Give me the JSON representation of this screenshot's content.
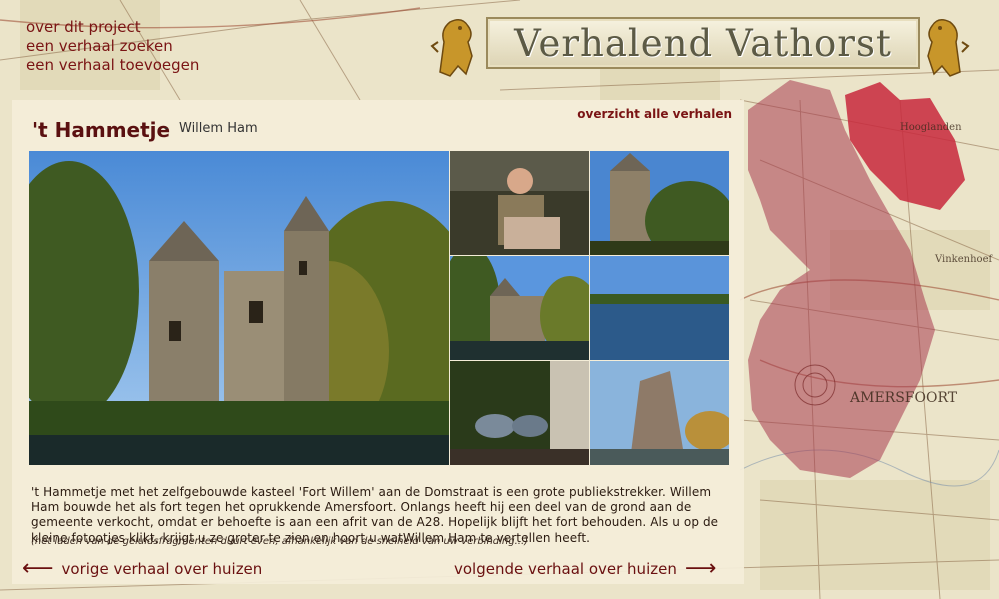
{
  "nav": {
    "items": [
      "over dit project",
      "een verhaal zoeken",
      "een verhaal toevoegen"
    ]
  },
  "banner": {
    "title": "Verhalend Vathorst"
  },
  "story": {
    "title": "'t Hammetje",
    "separator": "-",
    "author": "Willem Ham",
    "overview_link": "overzicht alle verhalen",
    "text": "'t Hammetje met het zelfgebouwde kasteel 'Fort Willem' aan de Domstraat is een grote publiekstrekker. Willem Ham bouwde het als fort tegen het oprukkende Amersfoort. Onlangs heeft hij een deel van de grond aan de gemeente verkocht, omdat er behoefte is aan een afrit van de A28. Hopelijk blijft het fort behouden. Als u op de kleine fotootjes klikt, krijgt u ze groter te zien en hoort u watWillem Ham te vertellen heeft.",
    "note": "(het laden van de geluidsfragmenten duurt even, afhankelijk van de snelheid van uw verbinding...)"
  },
  "footer_nav": {
    "prev_label": "vorige verhaal over huizen",
    "next_label": "volgende verhaal over huizen",
    "prev_arrow": "⟵",
    "next_arrow": "⟶"
  },
  "map_labels": {
    "town": "AMERSFOORT",
    "place1": "Hooglanden",
    "place2": "Vinkenhoef"
  },
  "colors": {
    "accent": "#7a1414",
    "panel_bg": "#f4eed9",
    "map_overlay": "#a83a4f",
    "highlight": "#c8283c"
  }
}
